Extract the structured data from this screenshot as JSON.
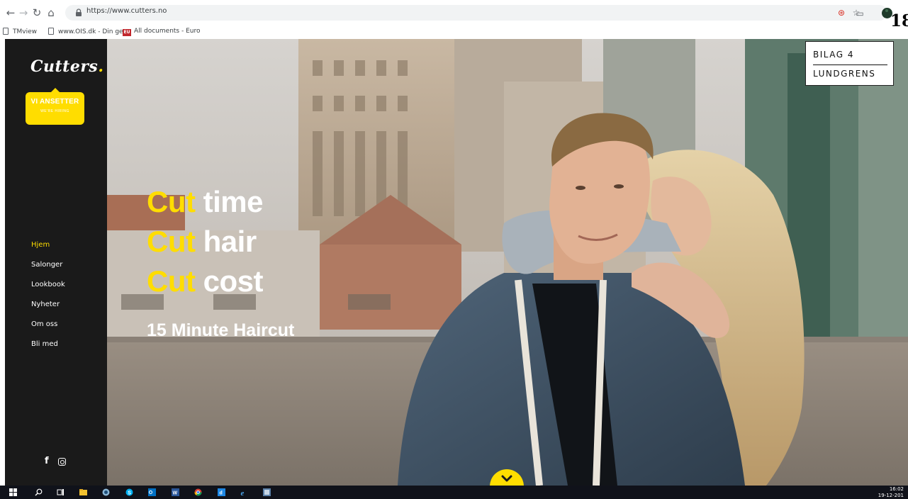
{
  "browser": {
    "url": "https://www.cutters.no",
    "bookmarks": [
      {
        "label": "TMview"
      },
      {
        "label": "www.OIS.dk - Din ge"
      },
      {
        "label": "All documents - Euro",
        "badge": "EU"
      }
    ]
  },
  "page_number": "18",
  "site": {
    "logo": {
      "text": "Cutters",
      "dot": "."
    },
    "hiring": {
      "main": "VI ANSETTER",
      "sub": "WE'RE HIRING"
    },
    "nav": [
      {
        "label": "Hjem",
        "active": true
      },
      {
        "label": "Salonger"
      },
      {
        "label": "Lookbook"
      },
      {
        "label": "Nyheter"
      },
      {
        "label": "Om oss"
      },
      {
        "label": "Bli med"
      }
    ],
    "social": {
      "facebook": "f",
      "instagram": "instagram-icon"
    },
    "hero": {
      "lines": [
        {
          "keyword": "Cut",
          "rest": " time"
        },
        {
          "keyword": "Cut",
          "rest": " hair"
        },
        {
          "keyword": "Cut",
          "rest": " cost"
        }
      ],
      "tagline": "15 Minute Haircut"
    },
    "stamp": {
      "top": "BILAG 4",
      "bottom": "LUNDGRENS"
    }
  },
  "taskbar": {
    "time": "16:02",
    "date": "19-12-201"
  },
  "colors": {
    "accent": "#ffdd00",
    "sidebar": "#1a1a1a",
    "taskbar": "#10121a"
  }
}
